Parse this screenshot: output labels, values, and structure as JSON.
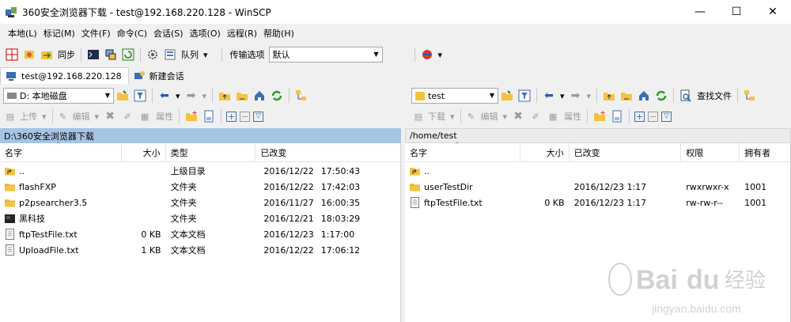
{
  "window": {
    "title": "360安全浏览器下载 - test@192.168.220.128 - WinSCP",
    "minimize": "—",
    "maximize": "☐",
    "close": "✕"
  },
  "menu": [
    "本地(L)",
    "标记(M)",
    "文件(F)",
    "命令(C)",
    "会话(S)",
    "选项(O)",
    "远程(R)",
    "帮助(H)"
  ],
  "toolbar": {
    "sync_label": "同步",
    "queue_label": "队列",
    "transfer_label": "传输选项",
    "transfer_value": "默认"
  },
  "tabs": [
    {
      "label": "test@192.168.220.128",
      "active": true
    },
    {
      "label": "新建会话",
      "active": false
    }
  ],
  "left": {
    "drive": "D: 本地磁盘",
    "upload_label": "上传",
    "edit_label": "编辑",
    "props_label": "属性",
    "path": "D:\\360安全浏览器下载",
    "columns": [
      "名字",
      "大小",
      "类型",
      "已改变"
    ],
    "files": [
      {
        "name": "..",
        "size": "",
        "type": "上级目录",
        "date": "2016/12/22",
        "time": "17:50:43",
        "icon": "parent-dir"
      },
      {
        "name": "flashFXP",
        "size": "",
        "type": "文件夹",
        "date": "2016/12/22",
        "time": "17:42:03",
        "icon": "folder"
      },
      {
        "name": "p2psearcher3.5",
        "size": "",
        "type": "文件夹",
        "date": "2016/11/27",
        "time": "16:00:35",
        "icon": "folder"
      },
      {
        "name": "黑科技",
        "size": "",
        "type": "文件夹",
        "date": "2016/12/21",
        "time": "18:03:29",
        "icon": "folder-dark"
      },
      {
        "name": "ftpTestFile.txt",
        "size": "0 KB",
        "type": "文本文档",
        "date": "2016/12/23",
        "time": "1:17:00",
        "icon": "text-file"
      },
      {
        "name": "UploadFile.txt",
        "size": "1 KB",
        "type": "文本文档",
        "date": "2016/12/22",
        "time": "17:06:12",
        "icon": "text-file"
      }
    ]
  },
  "right": {
    "dir": "test",
    "find_label": "查找文件",
    "download_label": "下载",
    "edit_label": "编辑",
    "props_label": "属性",
    "path": "/home/test",
    "columns": [
      "名字",
      "大小",
      "已改变",
      "权限",
      "拥有者"
    ],
    "files": [
      {
        "name": "..",
        "size": "",
        "changed": "",
        "perms": "",
        "owner": "",
        "icon": "parent-dir"
      },
      {
        "name": "userTestDir",
        "size": "",
        "changed": "2016/12/23 1:17",
        "perms": "rwxrwxr-x",
        "owner": "1001",
        "icon": "folder"
      },
      {
        "name": "ftpTestFile.txt",
        "size": "0 KB",
        "changed": "2016/12/23 1:17",
        "perms": "rw-rw-r--",
        "owner": "1001",
        "icon": "text-file"
      }
    ]
  },
  "watermark": {
    "text": "Bai du 经验",
    "url": "jingyan.baidu.com"
  }
}
